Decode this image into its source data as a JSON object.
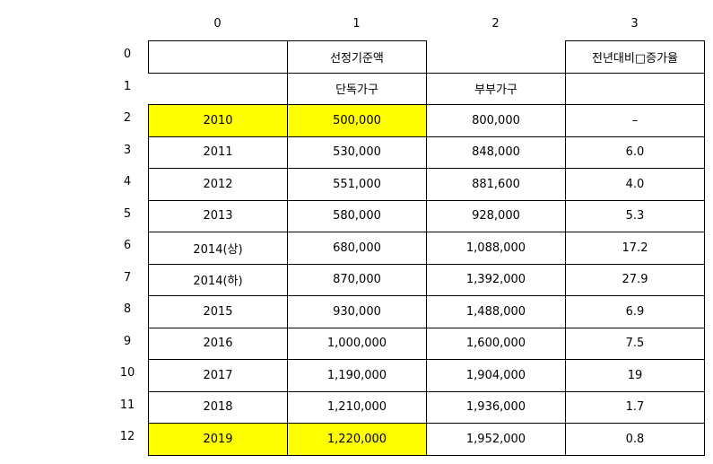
{
  "column_headers": [
    "0",
    "1",
    "2",
    "3"
  ],
  "row_headers": [
    "0",
    "1",
    "2",
    "3",
    "4",
    "5",
    "6",
    "7",
    "8",
    "9",
    "10",
    "11",
    "12"
  ],
  "header_row0": {
    "c0": "",
    "c1": "선정기준액",
    "c2": "",
    "c3": "전년대비□증가율"
  },
  "header_row1": {
    "c0": "",
    "c1": "단독가구",
    "c2": "부부가구",
    "c3": ""
  },
  "rows": [
    {
      "year": "2010",
      "single": "500,000",
      "couple": "800,000",
      "rate": "–"
    },
    {
      "year": "2011",
      "single": "530,000",
      "couple": "848,000",
      "rate": "6.0"
    },
    {
      "year": "2012",
      "single": "551,000",
      "couple": "881,600",
      "rate": "4.0"
    },
    {
      "year": "2013",
      "single": "580,000",
      "couple": "928,000",
      "rate": "5.3"
    },
    {
      "year": "2014(상)",
      "single": "680,000",
      "couple": "1,088,000",
      "rate": "17.2"
    },
    {
      "year": "2014(하)",
      "single": "870,000",
      "couple": "1,392,000",
      "rate": "27.9"
    },
    {
      "year": "2015",
      "single": "930,000",
      "couple": "1,488,000",
      "rate": "6.9"
    },
    {
      "year": "2016",
      "single": "1,000,000",
      "couple": "1,600,000",
      "rate": "7.5"
    },
    {
      "year": "2017",
      "single": "1,190,000",
      "couple": "1,904,000",
      "rate": "19"
    },
    {
      "year": "2018",
      "single": "1,210,000",
      "couple": "1,936,000",
      "rate": "1.7"
    },
    {
      "year": "2019",
      "single": "1,220,000",
      "couple": "1,952,000",
      "rate": "0.8"
    }
  ],
  "highlight_color": "#ffff00"
}
